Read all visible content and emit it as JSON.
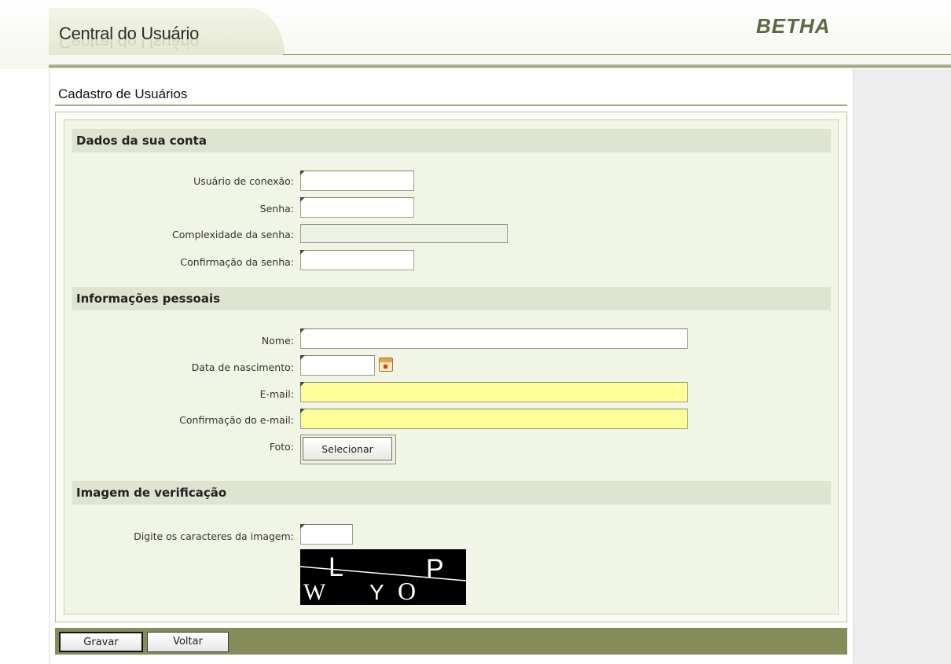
{
  "header": {
    "app_title": "Central do Usuário",
    "brand": "BETHA"
  },
  "page": {
    "title": "Cadastro de Usuários"
  },
  "sections": {
    "account": {
      "heading": "Dados da sua conta",
      "username_label": "Usuário de conexão:",
      "password_label": "Senha:",
      "complexity_label": "Complexidade da senha:",
      "confirm_password_label": "Confirmação da senha:"
    },
    "personal": {
      "heading": "Informações pessoais",
      "name_label": "Nome:",
      "birthdate_label": "Data de nascimento:",
      "email_label": "E-mail:",
      "confirm_email_label": "Confirmação do e-mail:",
      "photo_label": "Foto:",
      "select_button": "Selecionar"
    },
    "verification": {
      "heading": "Imagem de verificação",
      "captcha_label": "Digite os caracteres da imagem:",
      "captcha_text": "WLYOP"
    }
  },
  "actions": {
    "save": "Gravar",
    "back": "Voltar"
  },
  "colors": {
    "header_bar": "#8a9768",
    "action_bar": "#868c58",
    "section_bg": "#dfe4d0",
    "highlight_field": "#ffff99"
  },
  "icons": {
    "calendar": "calendar-icon"
  }
}
